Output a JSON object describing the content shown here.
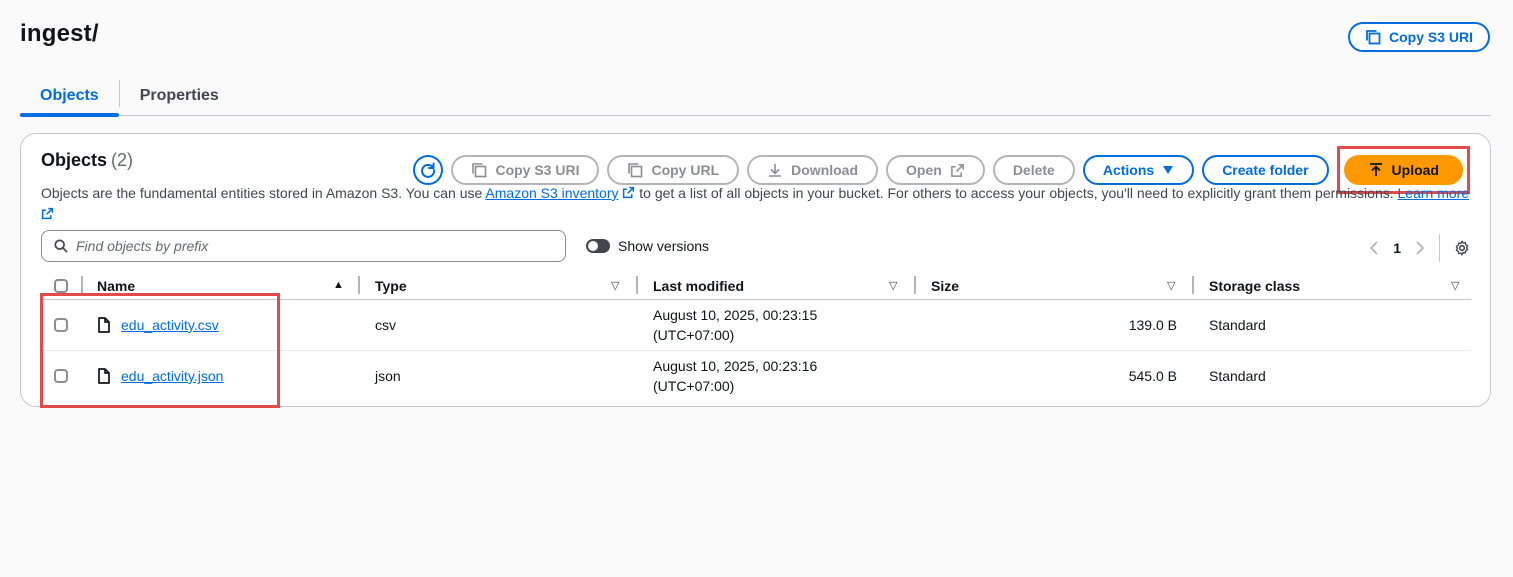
{
  "header": {
    "title": "ingest/",
    "copy_s3_uri_label": "Copy S3 URI"
  },
  "tabs": [
    {
      "label": "Objects",
      "active": true
    },
    {
      "label": "Properties",
      "active": false
    }
  ],
  "objects_panel": {
    "title": "Objects",
    "count": "(2)",
    "toolbar": {
      "copy_s3_uri": "Copy S3 URI",
      "copy_url": "Copy URL",
      "download": "Download",
      "open": "Open",
      "delete": "Delete",
      "actions": "Actions",
      "create_folder": "Create folder",
      "upload": "Upload"
    },
    "description": {
      "part1": "Objects are the fundamental entities stored in Amazon S3. You can use ",
      "link1": "Amazon S3 inventory",
      "part2": " to get a list of all objects in your bucket. For others to access your objects, you'll need to explicitly grant them permissions. ",
      "link2": "Learn more"
    },
    "search": {
      "placeholder": "Find objects by prefix"
    },
    "show_versions_label": "Show versions",
    "pagination": {
      "current_page": "1"
    },
    "columns": {
      "name": "Name",
      "type": "Type",
      "last_modified": "Last modified",
      "size": "Size",
      "storage_class": "Storage class"
    },
    "rows": [
      {
        "name": "edu_activity.csv",
        "type": "csv",
        "modified_line1": "August 10, 2025, 00:23:15",
        "modified_line2": "(UTC+07:00)",
        "size": "139.0 B",
        "storage_class": "Standard"
      },
      {
        "name": "edu_activity.json",
        "type": "json",
        "modified_line1": "August 10, 2025, 00:23:16",
        "modified_line2": "(UTC+07:00)",
        "size": "545.0 B",
        "storage_class": "Standard"
      }
    ]
  },
  "colors": {
    "primary_blue": "#006ce0",
    "upload_orange": "#ff9900",
    "highlight_red": "#e34a4a"
  }
}
